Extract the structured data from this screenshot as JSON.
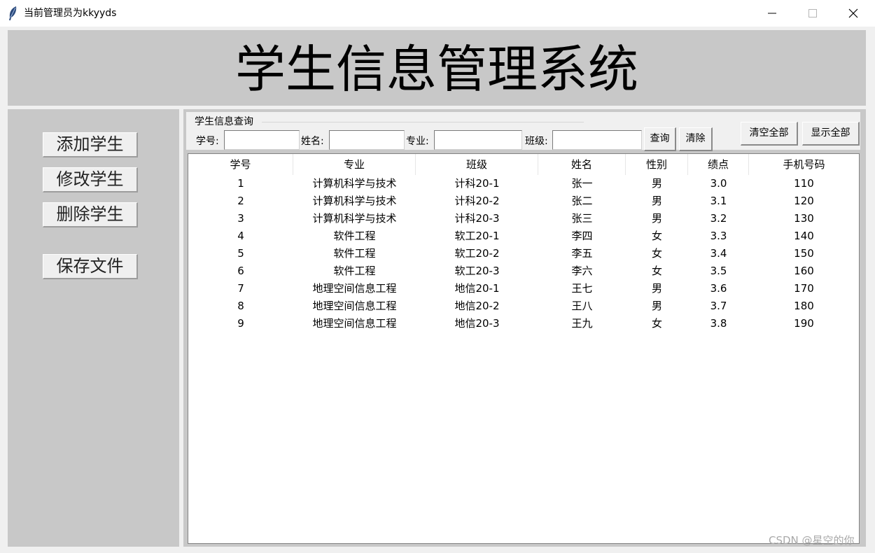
{
  "window": {
    "title": "当前管理员为kkyyds",
    "controls": [
      "minimize-icon",
      "maximize-icon",
      "close-icon"
    ]
  },
  "header": {
    "title": "学生信息管理系统"
  },
  "sidebar": {
    "buttons": [
      {
        "label": "添加学生"
      },
      {
        "label": "修改学生"
      },
      {
        "label": "删除学生"
      },
      {
        "label": "保存文件"
      }
    ]
  },
  "query": {
    "group_label": "学生信息查询",
    "fields": [
      {
        "label": "学号:",
        "value": ""
      },
      {
        "label": "姓名:",
        "value": ""
      },
      {
        "label": "专业:",
        "value": ""
      },
      {
        "label": "班级:",
        "value": ""
      }
    ],
    "search_label": "查询",
    "clear_label": "清除",
    "clear_all_label": "清空全部",
    "show_all_label": "显示全部"
  },
  "table": {
    "columns": [
      "学号",
      "专业",
      "班级",
      "姓名",
      "性别",
      "绩点",
      "手机号码"
    ],
    "rows": [
      [
        "1",
        "计算机科学与技术",
        "计科20-1",
        "张一",
        "男",
        "3.0",
        "110"
      ],
      [
        "2",
        "计算机科学与技术",
        "计科20-2",
        "张二",
        "男",
        "3.1",
        "120"
      ],
      [
        "3",
        "计算机科学与技术",
        "计科20-3",
        "张三",
        "男",
        "3.2",
        "130"
      ],
      [
        "4",
        "软件工程",
        "软工20-1",
        "李四",
        "女",
        "3.3",
        "140"
      ],
      [
        "5",
        "软件工程",
        "软工20-2",
        "李五",
        "女",
        "3.4",
        "150"
      ],
      [
        "6",
        "软件工程",
        "软工20-3",
        "李六",
        "女",
        "3.5",
        "160"
      ],
      [
        "7",
        "地理空间信息工程",
        "地信20-1",
        "王七",
        "男",
        "3.6",
        "170"
      ],
      [
        "8",
        "地理空间信息工程",
        "地信20-2",
        "王八",
        "男",
        "3.7",
        "180"
      ],
      [
        "9",
        "地理空间信息工程",
        "地信20-3",
        "王九",
        "女",
        "3.8",
        "190"
      ]
    ]
  },
  "watermark": "CSDN @星空的你"
}
